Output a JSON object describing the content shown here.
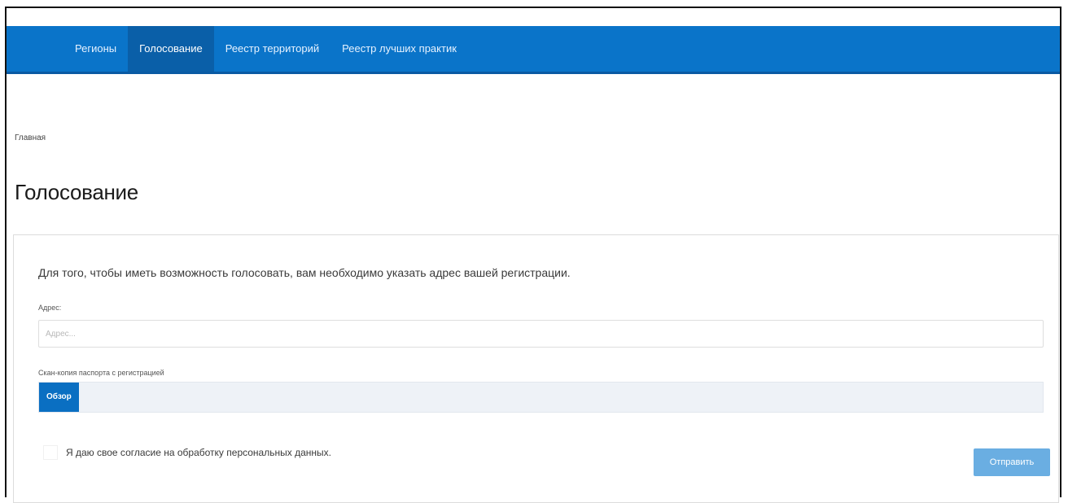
{
  "nav": {
    "items": [
      {
        "label": "Регионы"
      },
      {
        "label": "Голосование"
      },
      {
        "label": "Реестр территорий"
      },
      {
        "label": "Реестр лучших практик"
      }
    ],
    "active_index": 1
  },
  "breadcrumb": {
    "home": "Главная"
  },
  "page": {
    "title": "Голосование"
  },
  "form": {
    "intro": "Для того, чтобы иметь возможность голосовать, вам необходимо указать адрес вашей регистрации.",
    "address_label": "Адрес:",
    "address_placeholder": "Адрес...",
    "address_value": "",
    "passport_label": "Скан-копия паспорта с регистрацией",
    "browse_label": "Обзор",
    "consent_label": "Я даю свое согласие на обработку персональных данных.",
    "consent_checked": false,
    "submit_label": "Отправить"
  },
  "colors": {
    "navbar": "#0a74c9",
    "nav_active": "#0a5fa8",
    "browse_button": "#0a6fc2",
    "submit_button": "#6aaee2"
  }
}
